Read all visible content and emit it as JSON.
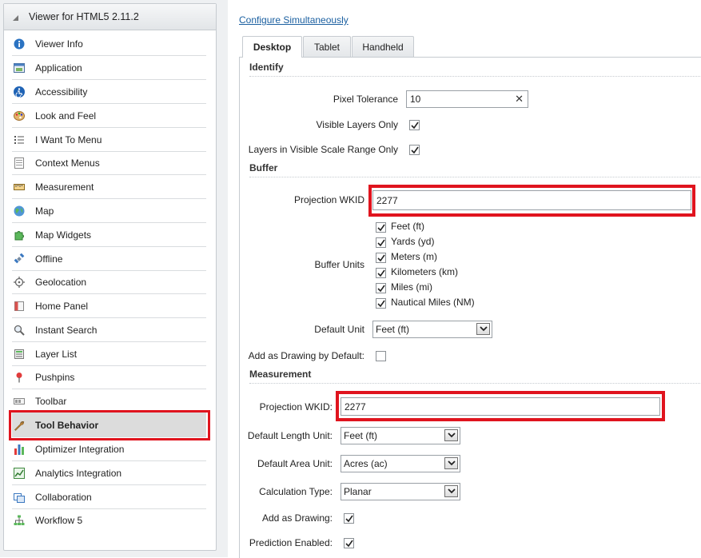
{
  "panel": {
    "title": "Viewer for HTML5 2.11.2"
  },
  "nav": [
    {
      "label": "Viewer Info",
      "icon": "info-icon"
    },
    {
      "label": "Application",
      "icon": "application-icon"
    },
    {
      "label": "Accessibility",
      "icon": "accessibility-icon"
    },
    {
      "label": "Look and Feel",
      "icon": "palette-icon"
    },
    {
      "label": "I Want To Menu",
      "icon": "list-icon"
    },
    {
      "label": "Context Menus",
      "icon": "menu-icon"
    },
    {
      "label": "Measurement",
      "icon": "ruler-icon"
    },
    {
      "label": "Map",
      "icon": "globe-icon"
    },
    {
      "label": "Map Widgets",
      "icon": "puzzle-icon"
    },
    {
      "label": "Offline",
      "icon": "satellite-icon"
    },
    {
      "label": "Geolocation",
      "icon": "crosshair-icon"
    },
    {
      "label": "Home Panel",
      "icon": "home-icon"
    },
    {
      "label": "Instant Search",
      "icon": "search-icon"
    },
    {
      "label": "Layer List",
      "icon": "layers-icon"
    },
    {
      "label": "Pushpins",
      "icon": "pushpin-icon"
    },
    {
      "label": "Toolbar",
      "icon": "toolbar-icon"
    },
    {
      "label": "Tool Behavior",
      "icon": "wrench-icon"
    },
    {
      "label": "Optimizer Integration",
      "icon": "bar-chart-icon"
    },
    {
      "label": "Analytics Integration",
      "icon": "analytics-icon"
    },
    {
      "label": "Collaboration",
      "icon": "collaboration-icon"
    },
    {
      "label": "Workflow 5",
      "icon": "workflow-icon"
    }
  ],
  "active_nav": "Tool Behavior",
  "config_link": "Configure Simultaneously",
  "tabs": [
    "Desktop",
    "Tablet",
    "Handheld"
  ],
  "active_tab": "Desktop",
  "identify": {
    "title": "Identify",
    "pixel_tolerance_label": "Pixel Tolerance",
    "pixel_tolerance_value": "10",
    "visible_layers_label": "Visible Layers Only",
    "visible_layers_checked": true,
    "scale_range_label": "Layers in Visible Scale Range Only",
    "scale_range_checked": true
  },
  "buffer": {
    "title": "Buffer",
    "wkid_label": "Projection WKID",
    "wkid_value": "2277",
    "units_label": "Buffer Units",
    "units": [
      {
        "label": "Feet (ft)",
        "checked": true
      },
      {
        "label": "Yards (yd)",
        "checked": true
      },
      {
        "label": "Meters (m)",
        "checked": true
      },
      {
        "label": "Kilometers (km)",
        "checked": true
      },
      {
        "label": "Miles (mi)",
        "checked": true
      },
      {
        "label": "Nautical Miles (NM)",
        "checked": true
      }
    ],
    "default_unit_label": "Default Unit",
    "default_unit_value": "Feet (ft)",
    "drawing_label": "Add as Drawing by Default:",
    "drawing_checked": false
  },
  "measurement": {
    "title": "Measurement",
    "wkid_label": "Projection WKID:",
    "wkid_value": "2277",
    "length_label": "Default Length Unit:",
    "length_value": "Feet (ft)",
    "area_label": "Default Area Unit:",
    "area_value": "Acres (ac)",
    "calc_label": "Calculation Type:",
    "calc_value": "Planar",
    "drawing_label": "Add as Drawing:",
    "drawing_checked": true,
    "prediction_label": "Prediction Enabled:",
    "prediction_checked": true
  },
  "colors": {
    "highlight": "#e0141e",
    "link": "#1a5fa0"
  }
}
